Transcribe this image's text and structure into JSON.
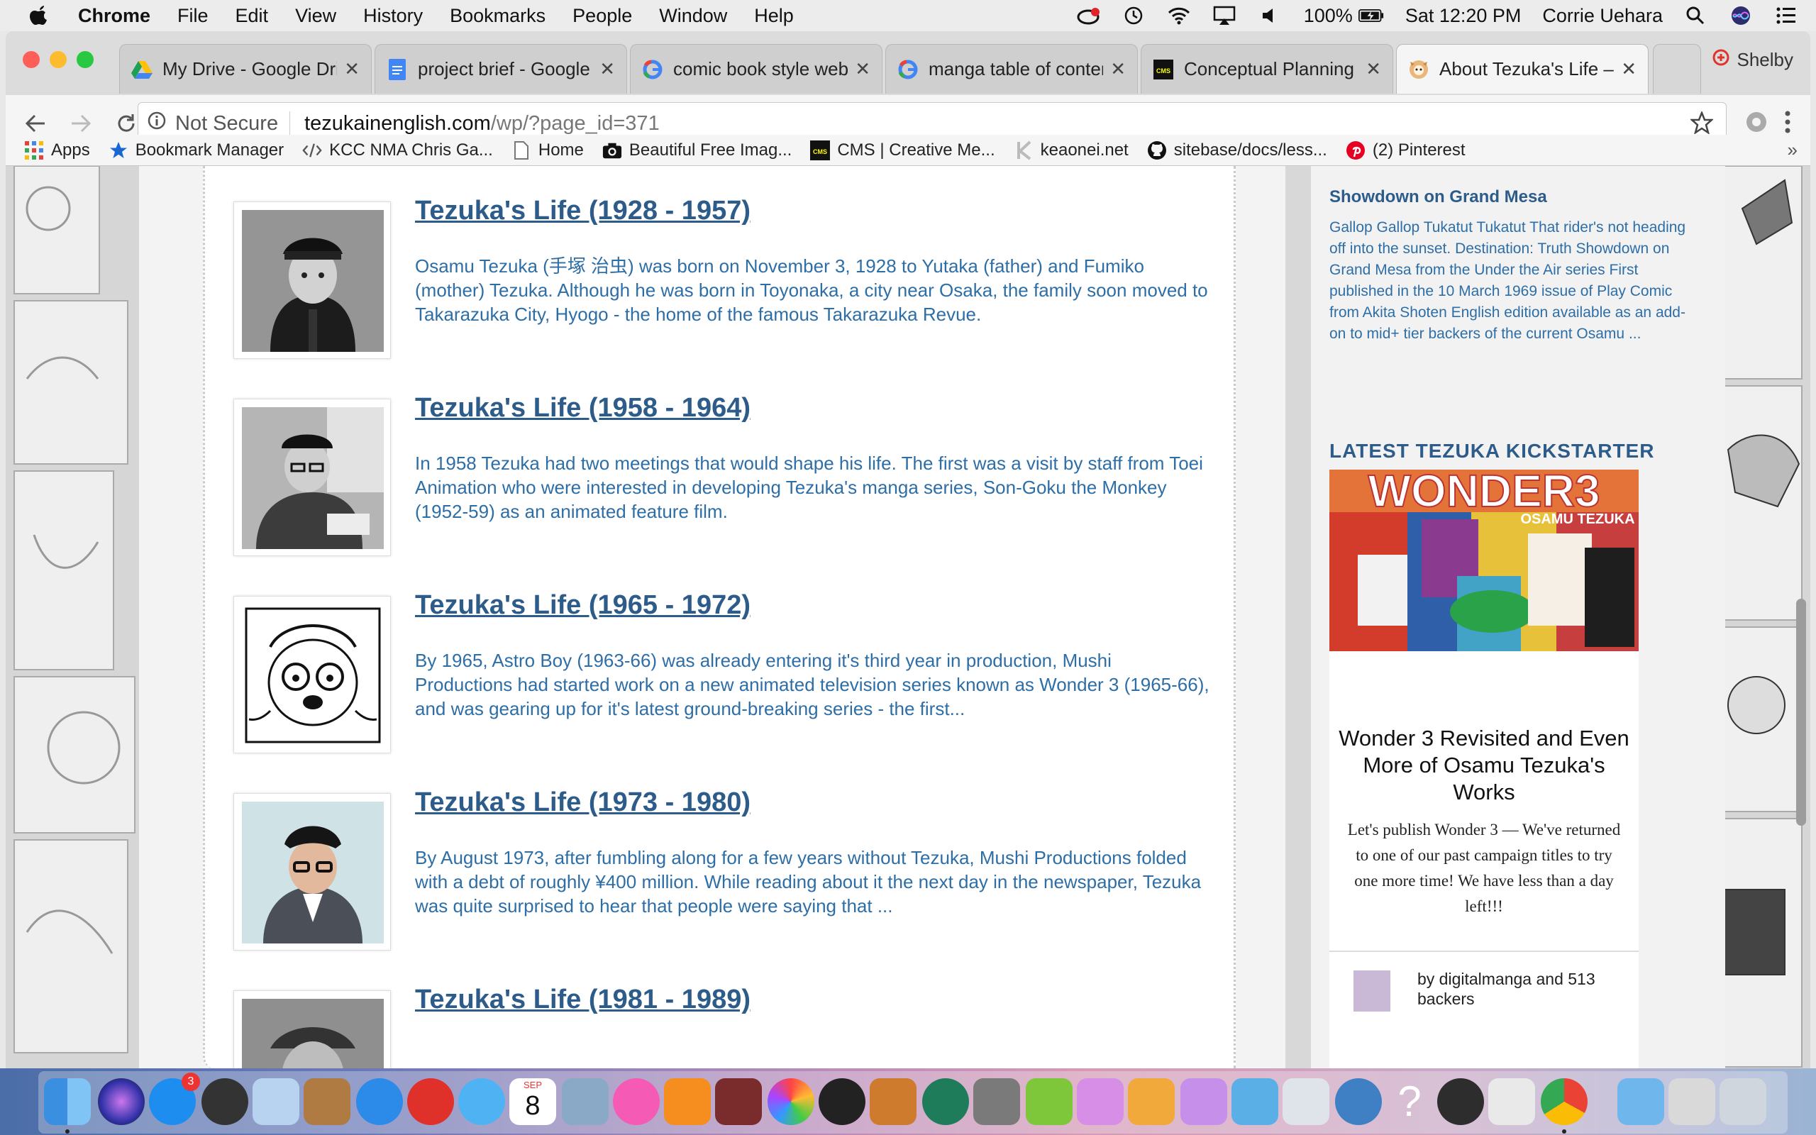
{
  "menubar": {
    "app_name": "Chrome",
    "items": [
      "File",
      "Edit",
      "View",
      "History",
      "Bookmarks",
      "People",
      "Window",
      "Help"
    ],
    "battery": "100%",
    "clock": "Sat 12:20 PM",
    "user": "Corrie Uehara"
  },
  "tabs": [
    {
      "title": "My Drive - Google Dri",
      "icon": "google-drive-icon"
    },
    {
      "title": "project brief - Google",
      "icon": "google-docs-icon"
    },
    {
      "title": "comic book style web",
      "icon": "google-icon"
    },
    {
      "title": "manga table of conten",
      "icon": "google-icon"
    },
    {
      "title": "Conceptual Planning |",
      "icon": "cms-icon"
    },
    {
      "title": "About Tezuka's Life –",
      "icon": "tezuka-site-icon"
    }
  ],
  "profile_name": "Shelby",
  "omnibox": {
    "security": "Not Secure",
    "host": "tezukainenglish.com",
    "path": "/wp/?page_id=371"
  },
  "bookmarks": [
    {
      "label": "Apps",
      "icon": "apps-grid-icon"
    },
    {
      "label": "Bookmark Manager",
      "icon": "star-icon"
    },
    {
      "label": "KCC NMA Chris Ga...",
      "icon": "code-icon"
    },
    {
      "label": "Home",
      "icon": "page-icon"
    },
    {
      "label": "Beautiful Free Imag...",
      "icon": "camera-icon"
    },
    {
      "label": "CMS | Creative Me...",
      "icon": "cms-icon"
    },
    {
      "label": "keaonei.net",
      "icon": "k-icon"
    },
    {
      "label": "sitebase/docs/less...",
      "icon": "github-icon"
    },
    {
      "label": "(2) Pinterest",
      "icon": "pinterest-icon"
    }
  ],
  "posts": [
    {
      "title": "Tezuka's Life (1928 - 1957)",
      "excerpt": "Osamu Tezuka (手塚 治虫) was born on November 3, 1928 to Yutaka (father) and Fumiko (mother) Tezuka. Although he was born in Toyonaka, a city near Osaka, the family soon moved to Takarazuka City, Hyogo - the home of the famous Takarazuka Revue."
    },
    {
      "title": "Tezuka's Life (1958 - 1964)",
      "excerpt": "In 1958 Tezuka had two meetings that would shape his life. The first was a visit by staff from Toei Animation who were interested in developing Tezuka's manga series, Son-Goku the Monkey (1952-59) as an animated feature film."
    },
    {
      "title": "Tezuka's Life (1965 - 1972)",
      "excerpt": "By 1965, Astro Boy (1963-66) was already entering it's third year in production, Mushi Productions had started work on a new animated television series known as Wonder 3 (1965-66), and was gearing up for it's latest ground-breaking series - the first..."
    },
    {
      "title": "Tezuka's Life (1973 - 1980)",
      "excerpt": "By August 1973, after fumbling along for a few years without Tezuka, Mushi Productions folded with a debt of roughly ¥400 million. While reading about it the next day in the newspaper, Tezuka was quite surprised to hear that people were saying that ..."
    },
    {
      "title": "Tezuka's Life (1981 - 1989)",
      "excerpt": ""
    }
  ],
  "sidebar": {
    "recent_post_title": "Showdown on Grand Mesa",
    "recent_post_excerpt": "Gallop Gallop Tukatut Tukatut That rider's not heading off into the sunset. Destination: Truth Showdown on Grand Mesa from the Under the Air series First published in the 10 March 1969 issue of Play Comic from Akita Shoten English edition available as an add-on to mid+ tier backers of the current Osamu ...",
    "kickstarter_heading": "LATEST TEZUKA KICKSTARTER",
    "banner_title": "WONDER3",
    "banner_subtitle": "OSAMU TEZUKA",
    "campaign_title": "Wonder 3 Revisited and Even More of Osamu Tezuka's Works",
    "campaign_blurb": "Let's publish Wonder 3 — We've returned to one of our past campaign titles to try one more time! We have less than a day left!!!",
    "campaign_by": "by digitalmanga and 513 backers"
  },
  "dock": {
    "calendar_month": "SEP",
    "calendar_day": "8",
    "app_store_badge": "3"
  },
  "colors": {
    "link_blue": "#2d5c8a",
    "excerpt_blue": "#2e6ea6"
  }
}
